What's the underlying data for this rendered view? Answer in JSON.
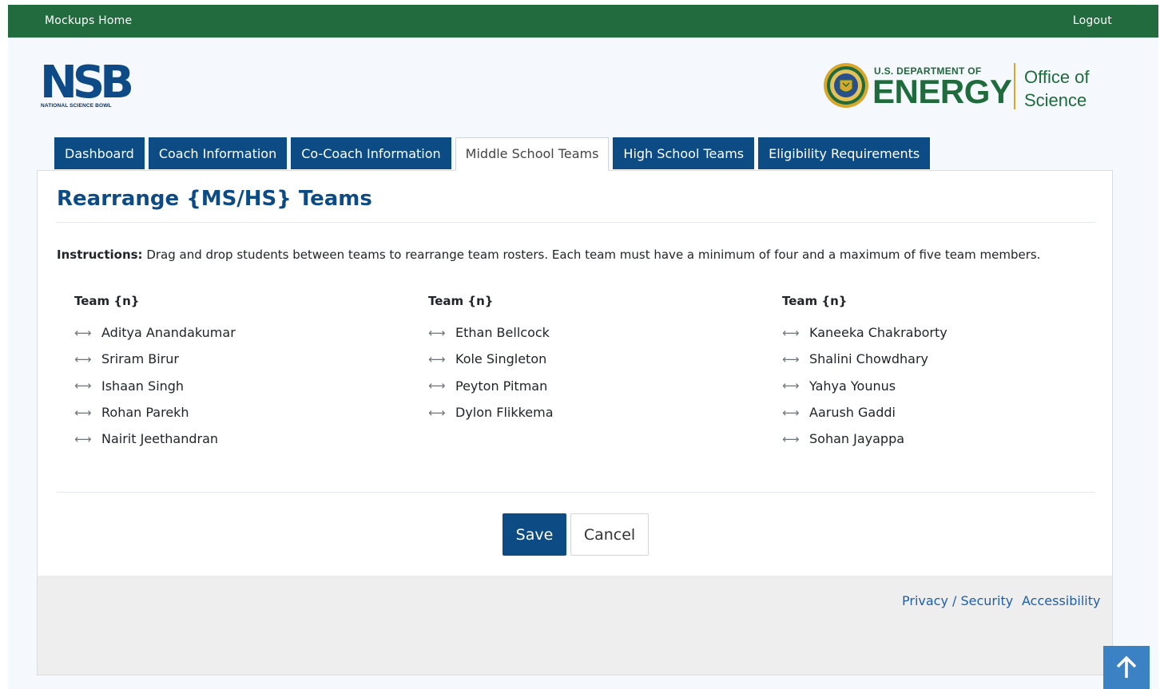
{
  "topbar": {
    "home": "Mockups Home",
    "logout": "Logout"
  },
  "branding": {
    "nsb_letters": "NSB",
    "nsb_subtitle": "NATIONAL SCIENCE BOWL",
    "doe_small": "U.S. DEPARTMENT OF",
    "doe_big": "ENERGY",
    "office_line1": "Office of",
    "office_line2": "Science"
  },
  "tabs": [
    {
      "label": "Dashboard",
      "active": false
    },
    {
      "label": "Coach Information",
      "active": false
    },
    {
      "label": "Co-Coach Information",
      "active": false
    },
    {
      "label": "Middle School Teams",
      "active": true
    },
    {
      "label": "High School Teams",
      "active": false
    },
    {
      "label": "Eligibility Requirements",
      "active": false
    }
  ],
  "page": {
    "title": "Rearrange {MS/HS} Teams",
    "instructions_label": "Instructions:",
    "instructions_text": " Drag and drop students between teams to rearrange team rosters. Each team must have a minimum of four and a maximum of five team members."
  },
  "teams": [
    {
      "name": "Team {n}",
      "members": [
        "Aditya Anandakumar",
        "Sriram Birur",
        "Ishaan Singh",
        "Rohan Parekh",
        "Nairit Jeethandran"
      ]
    },
    {
      "name": "Team {n}",
      "members": [
        "Ethan Bellcock",
        "Kole Singleton",
        "Peyton Pitman",
        "Dylon Flikkema"
      ]
    },
    {
      "name": "Team {n}",
      "members": [
        "Kaneeka Chakraborty",
        "Shalini Chowdhary",
        "Yahya Younus",
        "Aarush Gaddi",
        "Sohan Jayappa"
      ]
    }
  ],
  "icons": {
    "drag": "drag-handle-icon",
    "back_to_top": "arrow-up-icon"
  },
  "actions": {
    "save": "Save",
    "cancel": "Cancel"
  },
  "footer": {
    "privacy": "Privacy / Security",
    "accessibility": "Accessibility"
  },
  "colors": {
    "topbar": "#216b3f",
    "primary": "#0d4b85",
    "footer_bg": "#eeeeee",
    "link": "#1f5fa6",
    "to_top": "#3b82c4"
  }
}
